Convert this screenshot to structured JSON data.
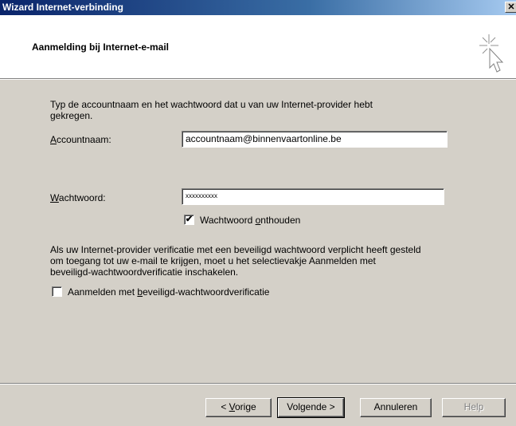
{
  "window": {
    "title": "Wizard Internet-verbinding",
    "close_label": "✕"
  },
  "header": {
    "title": "Aanmelding bij Internet-e-mail"
  },
  "intro": {
    "line1": "Typ de accountnaam en het wachtwoord dat u van uw Internet-provider hebt",
    "line2": "gekregen."
  },
  "account": {
    "label_key": "A",
    "label_rest": "ccountnaam:",
    "value": "accountnaam@binnenvaartonline.be"
  },
  "password": {
    "label_key": "W",
    "label_rest": "achtwoord:",
    "value": "xxxxxxxxxx"
  },
  "remember": {
    "checked": true,
    "check_glyph": "✔",
    "label_before": "Wachtwoord ",
    "label_key": "o",
    "label_after": "nthouden"
  },
  "spa_info": {
    "line1": "Als uw Internet-provider verificatie met een beveiligd wachtwoord verplicht heeft gesteld",
    "line2": "om toegang tot uw e-mail te krijgen, moet u het selectievakje Aanmelden met",
    "line3": "beveiligd-wachtwoordverificatie inschakelen."
  },
  "spa_checkbox": {
    "checked": false,
    "label_before": "Aanmelden met ",
    "label_key": "b",
    "label_after": "eveiligd-wachtwoordverificatie"
  },
  "buttons": {
    "back_prefix": "< ",
    "back_key": "V",
    "back_rest": "orige",
    "next": "Volgende >",
    "cancel": "Annuleren",
    "help": "Help"
  }
}
